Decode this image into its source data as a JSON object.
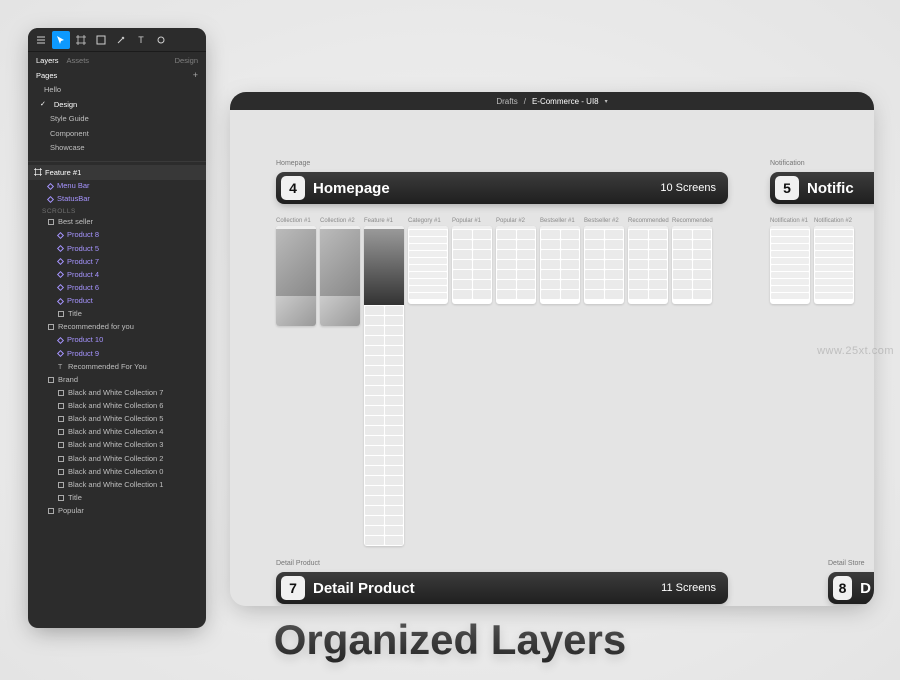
{
  "toolbar": {
    "tools": [
      "menu",
      "move",
      "frame",
      "rect",
      "pen",
      "text",
      "hand"
    ]
  },
  "tabs": {
    "layers": "Layers",
    "assets": "Assets",
    "design": "Design"
  },
  "pages": {
    "header": "Pages",
    "items": [
      {
        "label": "Hello",
        "active": false
      },
      {
        "label": "Design",
        "active": true
      },
      {
        "label": "Style Guide",
        "active": false,
        "sub": true
      },
      {
        "label": "Component",
        "active": false,
        "sub": true
      },
      {
        "label": "Showcase",
        "active": false,
        "sub": true
      }
    ]
  },
  "feature_header": "Feature  #1",
  "scrolls_label": "SCROLLS",
  "layers": [
    {
      "lbl": "Menu Bar",
      "type": "purple",
      "lv": 1
    },
    {
      "lbl": "StatusBar",
      "type": "purple",
      "lv": 1
    },
    {
      "lbl": "Best seller",
      "type": "frame",
      "lv": 1,
      "scrolls": true
    },
    {
      "lbl": "Product 8",
      "type": "purple",
      "lv": 2
    },
    {
      "lbl": "Product 5",
      "type": "purple",
      "lv": 2
    },
    {
      "lbl": "Product 7",
      "type": "purple",
      "lv": 2
    },
    {
      "lbl": "Product 4",
      "type": "purple",
      "lv": 2
    },
    {
      "lbl": "Product 6",
      "type": "purple",
      "lv": 2
    },
    {
      "lbl": "Product",
      "type": "purple",
      "lv": 2
    },
    {
      "lbl": "Title",
      "type": "frame",
      "lv": 2
    },
    {
      "lbl": "Recommended for you",
      "type": "frame",
      "lv": 1
    },
    {
      "lbl": "Product 10",
      "type": "purple",
      "lv": 2
    },
    {
      "lbl": "Product 9",
      "type": "purple",
      "lv": 2
    },
    {
      "lbl": "Recommended For You",
      "type": "text",
      "lv": 2
    },
    {
      "lbl": "Brand",
      "type": "frame",
      "lv": 1
    },
    {
      "lbl": "Black and White Collection 7",
      "type": "frame",
      "lv": 2
    },
    {
      "lbl": "Black and White Collection 6",
      "type": "frame",
      "lv": 2
    },
    {
      "lbl": "Black and White Collection 5",
      "type": "frame",
      "lv": 2
    },
    {
      "lbl": "Black and White Collection 4",
      "type": "frame",
      "lv": 2
    },
    {
      "lbl": "Black and White Collection 3",
      "type": "frame",
      "lv": 2
    },
    {
      "lbl": "Black and White Collection 2",
      "type": "frame",
      "lv": 2
    },
    {
      "lbl": "Black and White Collection 0",
      "type": "frame",
      "lv": 2
    },
    {
      "lbl": "Black and White Collection 1",
      "type": "frame",
      "lv": 2
    },
    {
      "lbl": "Title",
      "type": "frame",
      "lv": 2
    },
    {
      "lbl": "Popular",
      "type": "frame",
      "lv": 1
    }
  ],
  "canvas": {
    "breadcrumb_drafts": "Drafts",
    "breadcrumb_file": "E-Commerce - UI8",
    "sec4": {
      "group_label": "Homepage",
      "num": "4",
      "title": "Homepage",
      "count": "10 Screens"
    },
    "sec5": {
      "group_label": "Notification",
      "num": "5",
      "title": "Notific"
    },
    "sec7": {
      "group_label": "Detail Product",
      "num": "7",
      "title": "Detail Product",
      "count": "11 Screens"
    },
    "sec8": {
      "group_label": "Detail Store",
      "num": "8",
      "title": "D"
    },
    "frames_row1": [
      "Collection #1",
      "Collection #2",
      "Feature  #1",
      "Category #1",
      "Popular #1",
      "Popular #2",
      "Bestseller #1",
      "Bestseller #2",
      "Recommended",
      "Recommended"
    ],
    "frames_row2": [
      "Notification #1",
      "Notification #2"
    ]
  },
  "hero": "Organized Layers",
  "watermark": "www.25xt.com"
}
